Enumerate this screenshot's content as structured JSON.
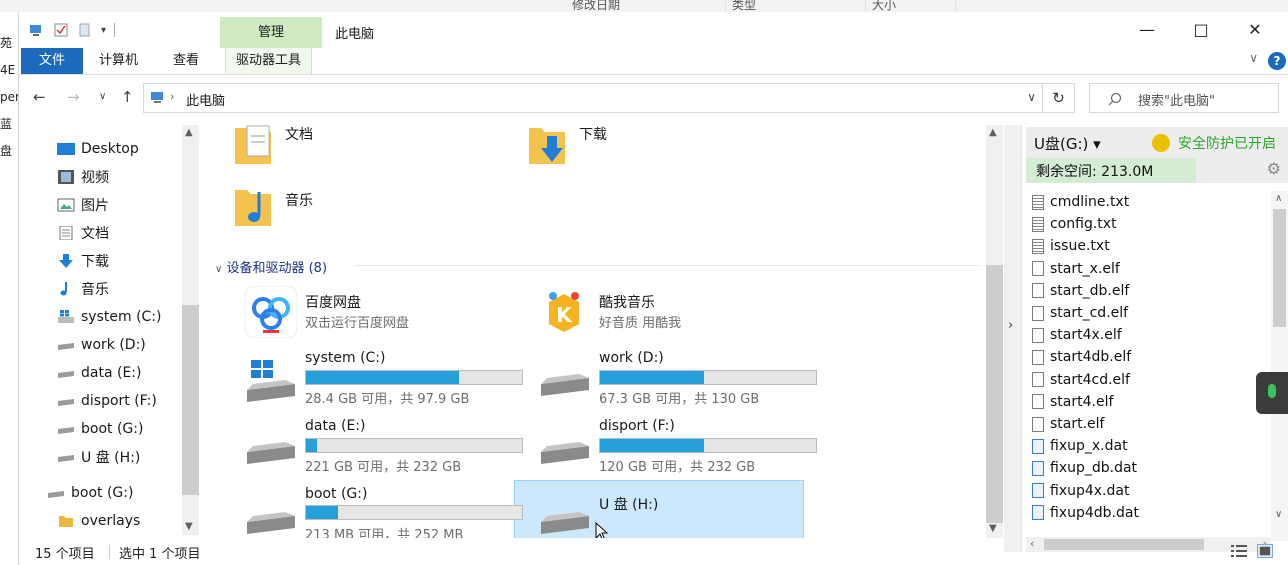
{
  "background": {
    "columns": [
      "修改日期",
      "类型",
      "大小"
    ],
    "left_fragments": [
      "苑4E",
      "per",
      "蓝盘"
    ]
  },
  "window": {
    "title": "此电脑",
    "manage_tab": "管理",
    "tabs": [
      "文件",
      "计算机",
      "查看",
      "驱动器工具"
    ]
  },
  "address": {
    "path": "此电脑",
    "search_placeholder": "搜索\"此电脑\""
  },
  "sidebar": {
    "items": [
      {
        "label": "Desktop",
        "icon": "desktop-icon"
      },
      {
        "label": "视频",
        "icon": "video-icon"
      },
      {
        "label": "图片",
        "icon": "picture-icon"
      },
      {
        "label": "文档",
        "icon": "document-icon"
      },
      {
        "label": "下载",
        "icon": "download-icon"
      },
      {
        "label": "音乐",
        "icon": "music-icon"
      },
      {
        "label": "system (C:)",
        "icon": "windows-drive-icon"
      },
      {
        "label": "work (D:)",
        "icon": "drive-icon"
      },
      {
        "label": "data (E:)",
        "icon": "drive-icon"
      },
      {
        "label": "disport (F:)",
        "icon": "drive-icon"
      },
      {
        "label": "boot (G:)",
        "icon": "drive-icon"
      },
      {
        "label": "U 盘 (H:)",
        "icon": "drive-icon"
      },
      {
        "label": "boot (G:)",
        "icon": "drive-icon"
      },
      {
        "label": "overlays",
        "icon": "folder-icon"
      }
    ]
  },
  "main": {
    "folders": [
      {
        "label": "文档"
      },
      {
        "label": "下载"
      },
      {
        "label": "音乐"
      }
    ],
    "group_header": "设备和驱动器 (8)",
    "apps": [
      {
        "name": "百度网盘",
        "sub": "双击运行百度网盘"
      },
      {
        "name": "酷我音乐",
        "sub": "好音质 用酷我"
      }
    ],
    "drives": [
      {
        "name": "system (C:)",
        "info": "28.4 GB 可用，共 97.9 GB",
        "used": 0.71
      },
      {
        "name": "work (D:)",
        "info": "67.3 GB 可用，共 130 GB",
        "used": 0.48
      },
      {
        "name": "data (E:)",
        "info": "221 GB 可用，共 232 GB",
        "used": 0.05
      },
      {
        "name": "disport (F:)",
        "info": "120 GB 可用，共 232 GB",
        "used": 0.48
      },
      {
        "name": "boot (G:)",
        "info": "213 MB 可用，共 252 MB",
        "used": 0.15
      },
      {
        "name": "U 盘 (H:)",
        "info": "",
        "used": 0
      }
    ]
  },
  "rightpanel": {
    "drive_label": "U盘(G:) ▾",
    "safety": "安全防护已开启",
    "space": "剩余空间: 213.0M",
    "files": [
      {
        "name": "cmdline.txt",
        "type": "txt"
      },
      {
        "name": "config.txt",
        "type": "txt"
      },
      {
        "name": "issue.txt",
        "type": "txt"
      },
      {
        "name": "start_x.elf",
        "type": "elf"
      },
      {
        "name": "start_db.elf",
        "type": "elf"
      },
      {
        "name": "start_cd.elf",
        "type": "elf"
      },
      {
        "name": "start4x.elf",
        "type": "elf"
      },
      {
        "name": "start4db.elf",
        "type": "elf"
      },
      {
        "name": "start4cd.elf",
        "type": "elf"
      },
      {
        "name": "start4.elf",
        "type": "elf"
      },
      {
        "name": "start.elf",
        "type": "elf"
      },
      {
        "name": "fixup_x.dat",
        "type": "dat"
      },
      {
        "name": "fixup_db.dat",
        "type": "dat"
      },
      {
        "name": "fixup4x.dat",
        "type": "dat"
      },
      {
        "name": "fixup4db.dat",
        "type": "dat"
      }
    ]
  },
  "status": {
    "count": "15 个项目",
    "selected": "选中 1 个项目"
  },
  "colors": {
    "accent": "#1b6bbd",
    "manage_tab": "#cfe9c0",
    "bar_fill": "#26a0da",
    "selection": "#cce8ff",
    "safe_green": "#29a829"
  }
}
